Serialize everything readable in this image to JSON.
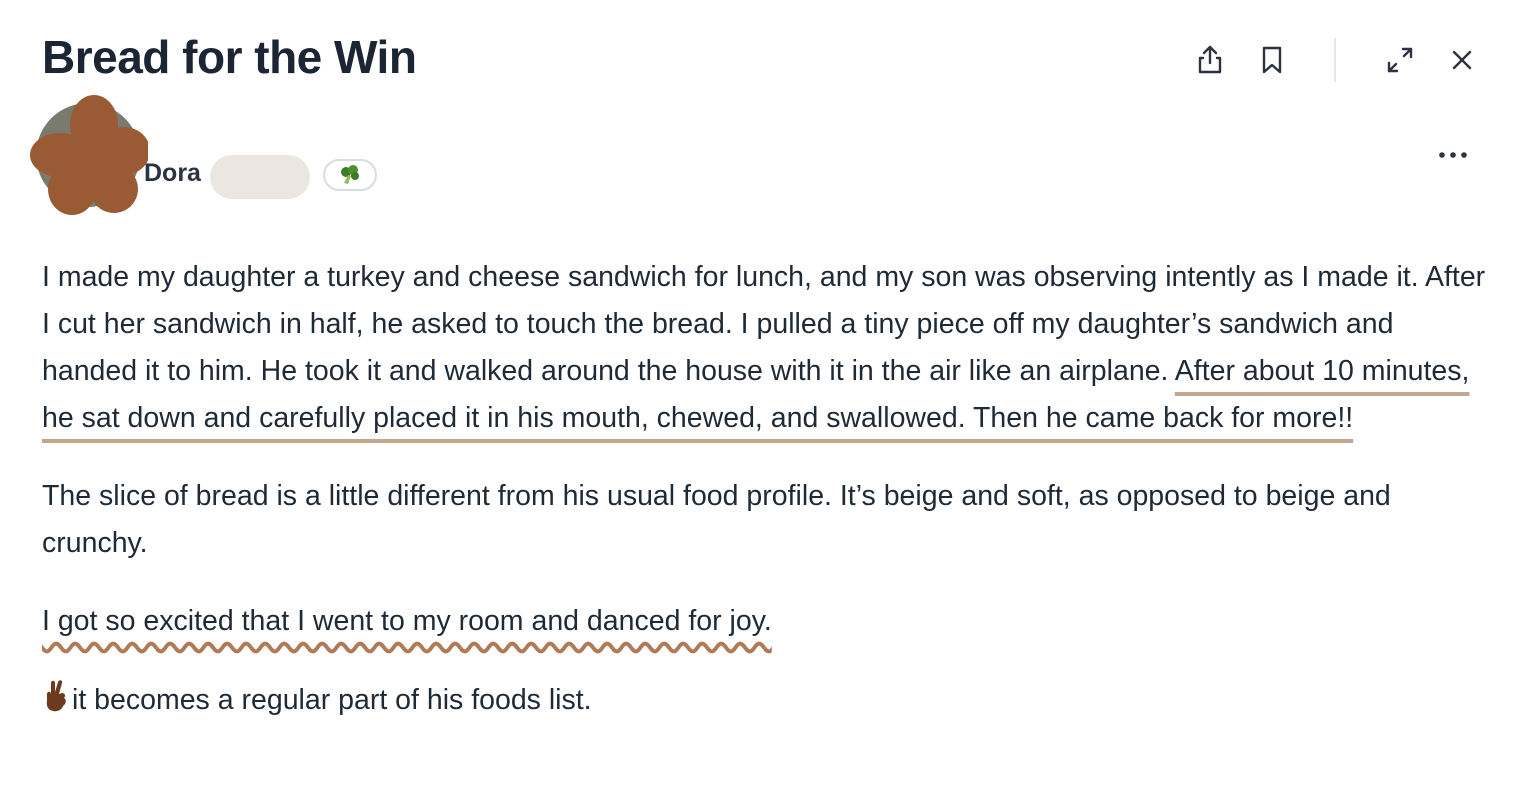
{
  "post": {
    "title": "Bread for the Win",
    "author": {
      "name": "Dora",
      "badge_icon": "broccoli-icon"
    },
    "paragraphs": {
      "p1_plain": "I made my daughter a turkey and cheese sandwich for lunch, and my son was observing intently as I made it. After I cut her sandwich in half, he asked to touch the bread. I pulled a tiny piece off my daughter’s sandwich and handed it to him. He took it and walked around the house with it in the air like an airplane. ",
      "p1_highlight": "After about 10 minutes, he sat down and carefully placed it in his mouth, chewed, and swallowed. Then he came back for more!!",
      "p2": "The slice of bread is a little different from his usual food profile. It’s beige and soft, as opposed to beige and crunchy.",
      "p3_highlight": "I got so excited that I went to my room and danced for joy.",
      "p4_icon": "crossed-fingers-icon",
      "p4": "it becomes a regular part of his foods list."
    }
  },
  "toolbar": {
    "icons": [
      "share-icon",
      "bookmark-icon",
      "expand-icon",
      "close-icon"
    ]
  },
  "colors": {
    "underline": "#c4a590",
    "wavy_underline": "#b07a56",
    "avatar_flower": "#9a5a34",
    "title": "#1b2533"
  }
}
